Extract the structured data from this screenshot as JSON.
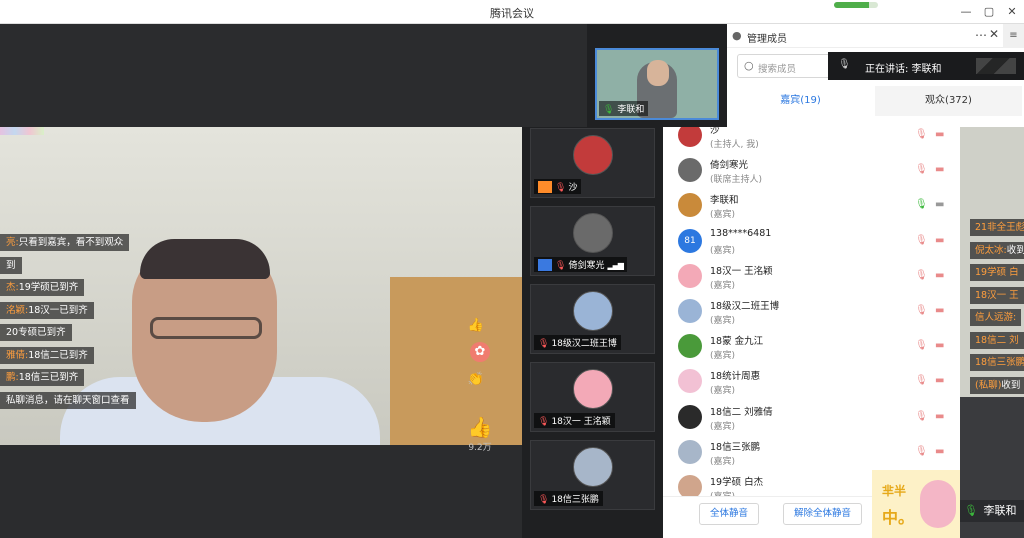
{
  "app": {
    "title": "腾讯会议",
    "network_quality": 0.8
  },
  "colors": {
    "accent": "#2c78e0",
    "mic_on": "#3cb83c",
    "muted": "#e98a8a",
    "chat_name": "#ff9e3d"
  },
  "icons": {
    "minimize": "—",
    "restore": "▢",
    "close": "✕",
    "more": "⋯",
    "menu": "≡",
    "search": "○",
    "user": "●",
    "mic": "🎙",
    "cam": "▬",
    "like": "👍",
    "flower": "✿",
    "clap": "👏",
    "signal": "▂▄▆"
  },
  "top_thumb": {
    "name": "李联和"
  },
  "speaking": {
    "label": "正在讲话: 李联和"
  },
  "panel": {
    "title": "管理成员",
    "search_placeholder": "搜索成员",
    "tab_guests": "嘉宾(19)",
    "tab_audience": "观众(372)",
    "mute_all": "全体静音",
    "unmute_all": "解除全体静音"
  },
  "members": [
    {
      "name": "沙",
      "role": "(主持人, 我)",
      "avatar_color": "#c23b3b",
      "avatar_text": "",
      "mic_on": false,
      "cam_on": false
    },
    {
      "name": "倚剑寒光",
      "role": "(联席主持人)",
      "avatar_color": "#6a6a6a",
      "avatar_text": "",
      "mic_on": false,
      "cam_on": false
    },
    {
      "name": "李联和",
      "role": "(嘉宾)",
      "avatar_color": "#c98a3a",
      "avatar_text": "",
      "mic_on": true,
      "cam_on": false
    },
    {
      "name": "138****6481",
      "role": "(嘉宾)",
      "avatar_color": "#2c78e0",
      "avatar_text": "81",
      "mic_on": false,
      "cam_on": false
    },
    {
      "name": "18汉一 王洺颖",
      "role": "(嘉宾)",
      "avatar_color": "#f3a9b7",
      "avatar_text": "",
      "mic_on": false,
      "cam_on": false
    },
    {
      "name": "18级汉二班王博",
      "role": "(嘉宾)",
      "avatar_color": "#9ab4d6",
      "avatar_text": "",
      "mic_on": false,
      "cam_on": false
    },
    {
      "name": "18蒙 金九江",
      "role": "(嘉宾)",
      "avatar_color": "#4a9a3a",
      "avatar_text": "",
      "mic_on": false,
      "cam_on": false
    },
    {
      "name": "18统计周惠",
      "role": "(嘉宾)",
      "avatar_color": "#f2c1d4",
      "avatar_text": "",
      "mic_on": false,
      "cam_on": false
    },
    {
      "name": "18信二 刘雅倩",
      "role": "(嘉宾)",
      "avatar_color": "#2a2a2a",
      "avatar_text": "",
      "mic_on": false,
      "cam_on": false
    },
    {
      "name": "18信三张鹏",
      "role": "(嘉宾)",
      "avatar_color": "#a7b6c9",
      "avatar_text": "",
      "mic_on": false,
      "cam_on": false
    },
    {
      "name": "19学硕 白杰",
      "role": "(嘉宾)",
      "avatar_color": "#d0a58c",
      "avatar_text": "",
      "mic_on": false,
      "cam_on": false
    }
  ],
  "guest_tiles": [
    {
      "name": "沙",
      "avatar_color": "#c23b3b",
      "role_badge": "orange"
    },
    {
      "name": "倚剑寒光",
      "avatar_color": "#6a6a6a",
      "role_badge": "blue"
    },
    {
      "name": "18级汉二班王博",
      "avatar_color": "#9ab4d6",
      "role_badge": ""
    },
    {
      "name": "18汉一 王洺颖",
      "avatar_color": "#f3a9b7",
      "role_badge": ""
    },
    {
      "name": "18信三张鹏",
      "avatar_color": "#a7b6c9",
      "role_badge": ""
    }
  ],
  "chat": [
    {
      "name": "亮:",
      "text": "只看到嘉宾，看不到观众"
    },
    {
      "name": "",
      "text": "到"
    },
    {
      "name": "杰:",
      "text": "19学硕已到齐"
    },
    {
      "name": "洺颖:",
      "text": "18汉一已到齐"
    },
    {
      "name": "",
      "text": "20专硕已到齐"
    },
    {
      "name": "雅倩:",
      "text": "18信二已到齐"
    },
    {
      "name": "鹏:",
      "text": "18信三已到齐"
    },
    {
      "name": "",
      "text": "私聊消息，请在聊天窗口查看"
    }
  ],
  "likes": {
    "count": "9.2万"
  },
  "right_chat": [
    {
      "name": "21非全王彪",
      "text": ""
    },
    {
      "name": "倪太冰:",
      "text": "收到"
    },
    {
      "name": "19学硕 白",
      "text": ""
    },
    {
      "name": "18汉一 王",
      "text": ""
    },
    {
      "name": "信人远游:",
      "text": ""
    },
    {
      "name": "18信二 刘",
      "text": ""
    },
    {
      "name": "18信三张鹏",
      "text": ""
    },
    {
      "name": "(私聊)",
      "text": "收到"
    }
  ],
  "sticker": {
    "line1": "芈半",
    "line2": "中。"
  },
  "speaker_label": "李联和"
}
